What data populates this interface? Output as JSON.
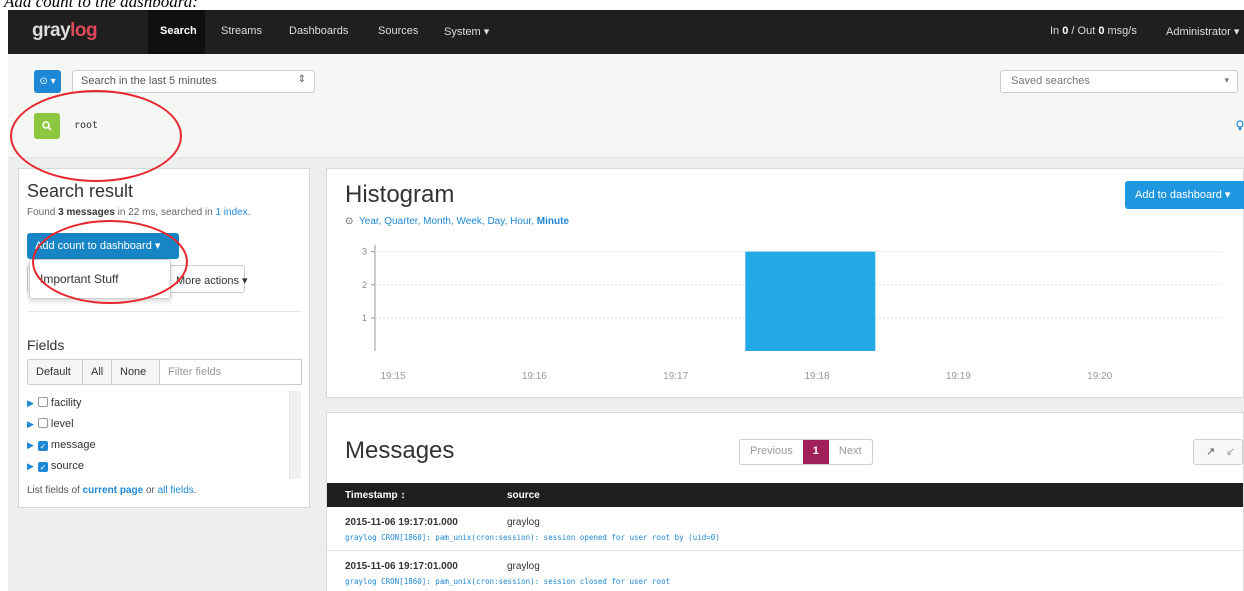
{
  "caption": "Add count to the dashboard:",
  "navbar": {
    "logo_prefix": "gray",
    "logo_suffix": "log",
    "items": [
      {
        "label": "Search",
        "active": true
      },
      {
        "label": "Streams"
      },
      {
        "label": "Dashboards"
      },
      {
        "label": "Sources"
      },
      {
        "label": "System ▾"
      }
    ],
    "throughput_prefix": "In ",
    "in_value": "0",
    "throughput_mid": " / Out ",
    "out_value": "0",
    "throughput_unit": " msg/s",
    "user": "Administrator ▾"
  },
  "search": {
    "time_button_icon": "clock-icon",
    "time_button_label": "⊙ ▾",
    "range": "Search in the last 5 minutes",
    "range_arrows": "⇕",
    "saved_searches_placeholder": "Saved searches",
    "saved_arrow": "▾",
    "search_button_icon": "search-icon",
    "search_button_glyph": "🔍",
    "query": "root",
    "hint_icon": "lightbulb-icon"
  },
  "search_result": {
    "title": "Search result",
    "found_prefix": "Found ",
    "found_count": "3 messages",
    "found_mid": " in 22 ms, searched in ",
    "found_link": "1 index",
    "found_suffix": ".",
    "add_count_button": "Add count to dashboard ▾",
    "more_actions_button": "More actions ▾",
    "dropdown_item": "Important Stuff"
  },
  "fields": {
    "title": "Fields",
    "tabs": [
      "Default",
      "All",
      "None"
    ],
    "filter_placeholder": "Filter fields",
    "items": [
      {
        "name": "facility",
        "checked": false
      },
      {
        "name": "level",
        "checked": false
      },
      {
        "name": "message",
        "checked": true
      },
      {
        "name": "source",
        "checked": true
      }
    ],
    "footer_prefix": "List fields of ",
    "footer_current": "current page",
    "footer_mid": " or ",
    "footer_all": "all fields",
    "footer_suffix": "."
  },
  "histogram": {
    "title": "Histogram",
    "resolutions": [
      "Year",
      "Quarter",
      "Month",
      "Week",
      "Day",
      "Hour",
      "Minute"
    ],
    "active_resolution": "Minute",
    "add_to_dashboard": "Add to dashboard ▾"
  },
  "chart_data": {
    "type": "bar",
    "categories": [
      "19:15",
      "19:16",
      "19:17",
      "19:18",
      "19:19",
      "19:20"
    ],
    "values": [
      0,
      0,
      3,
      0,
      0,
      0
    ],
    "yticks": [
      1,
      2,
      3
    ],
    "ylim": [
      0,
      3.2
    ],
    "grid": true,
    "color": "#23aae6"
  },
  "messages": {
    "title": "Messages",
    "pager": {
      "previous": "Previous",
      "current": "1",
      "next": "Next"
    },
    "expand_icon": "↗",
    "collapse_icon": "↙",
    "columns": [
      "Timestamp ↕",
      "source"
    ],
    "rows": [
      {
        "timestamp": "2015-11-06 19:17:01.000",
        "source": "graylog",
        "message": "graylog CRON[1860]: pam_unix(cron:session): session opened for user root by (uid=0)"
      },
      {
        "timestamp": "2015-11-06 19:17:01.000",
        "source": "graylog",
        "message": "graylog CRON[1860]: pam_unix(cron:session): session closed for user root"
      }
    ]
  }
}
